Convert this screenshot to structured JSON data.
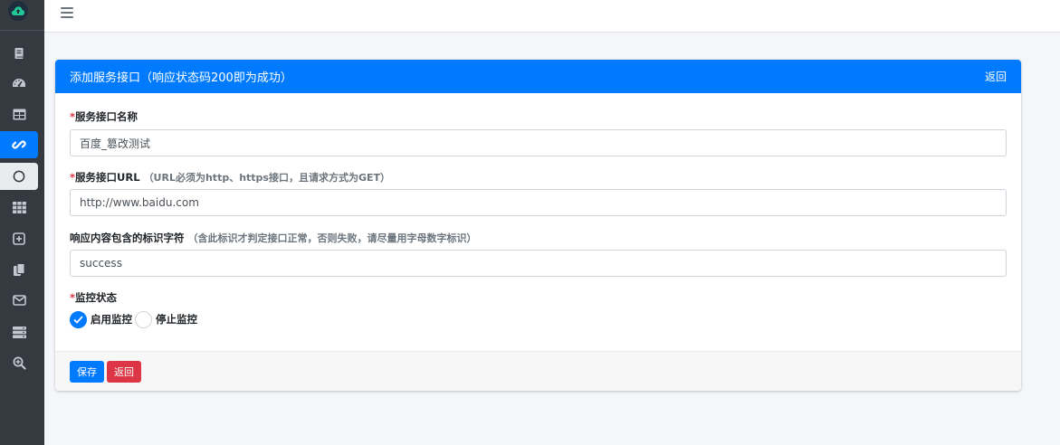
{
  "colors": {
    "primary": "#007bff",
    "danger": "#dc3545",
    "sidebar": "#343a40",
    "brand_icon": "#20c997"
  },
  "sidebar": {
    "icons": [
      "cloud-upload-icon",
      "book-icon",
      "tachometer-icon",
      "table-icon",
      "link-icon",
      "circle-icon",
      "grid-icon",
      "plus-square-icon",
      "copy-icon",
      "envelope-icon",
      "server-icon",
      "search-plus-icon"
    ],
    "active_item": "link-icon",
    "current_item": "circle-icon"
  },
  "topbar": {
    "menu_icon": "bars-icon"
  },
  "card": {
    "title": "添加服务接口（响应状态码200即为成功）",
    "back_link": "返回"
  },
  "form": {
    "name": {
      "required_mark": "*",
      "label": "服务接口名称",
      "value": "百度_篡改测试"
    },
    "url": {
      "required_mark": "*",
      "label": "服务接口URL",
      "hint": "（URL必须为http、https接口，且请求方式为GET）",
      "value": "http://www.baidu.com"
    },
    "keyword": {
      "label": "响应内容包含的标识字符",
      "hint": "（含此标识才判定接口正常，否则失败，请尽量用字母数字标识）",
      "value": "success"
    },
    "status": {
      "required_mark": "*",
      "label": "监控状态",
      "options": [
        "启用监控",
        "停止监控"
      ],
      "selected": "启用监控"
    }
  },
  "footer": {
    "save_button": "保存",
    "back_button": "返回"
  }
}
